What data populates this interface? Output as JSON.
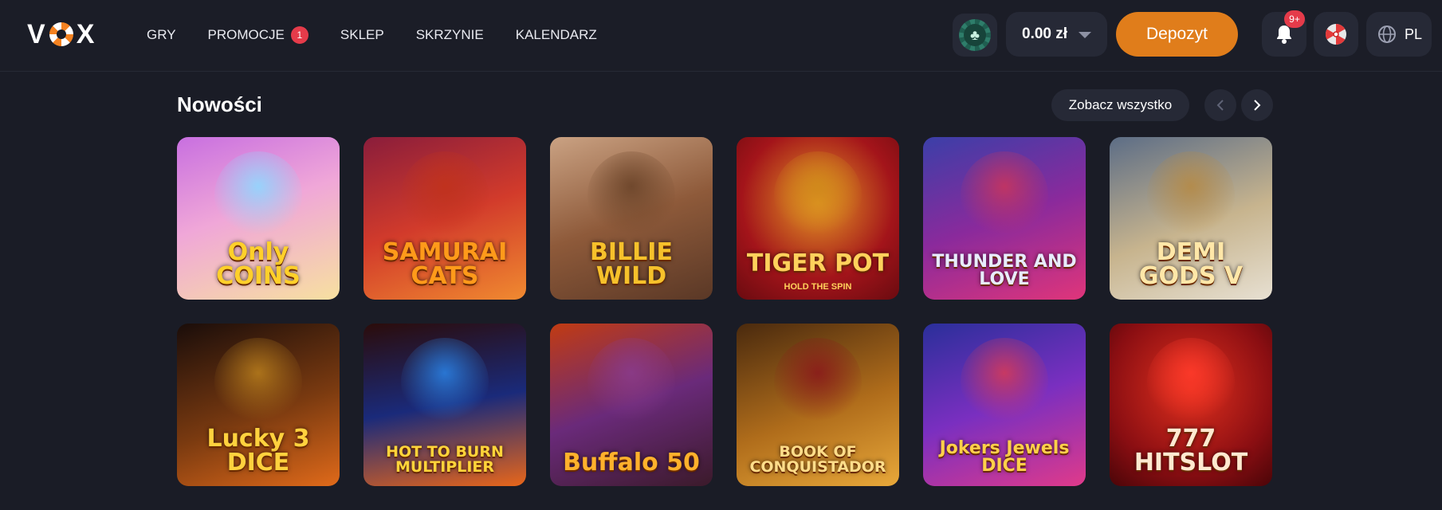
{
  "header": {
    "logo": "VOX",
    "nav": [
      {
        "label": "GRY"
      },
      {
        "label": "PROMOCJE",
        "badge": "1"
      },
      {
        "label": "SKLEP"
      },
      {
        "label": "SKRZYNIE"
      },
      {
        "label": "KALENDARZ"
      }
    ],
    "balance": "0.00 zł",
    "deposit_label": "Depozyt",
    "notifications_badge": "9+",
    "language": "PL"
  },
  "section": {
    "title": "Nowości",
    "see_all_label": "Zobacz wszystko"
  },
  "games": [
    {
      "title": "Only COINS",
      "bg": "linear-gradient(160deg,#c86fe0,#f0a7d8 45%,#f7e0a0)",
      "color": "#ffd02a",
      "art": "#8fd8ff"
    },
    {
      "title": "SAMURAI CATS",
      "bg": "linear-gradient(160deg,#8a1d3b,#d23b2b 50%,#f08a30)",
      "color": "#ff9a1a",
      "art": "#c0321c"
    },
    {
      "title": "BILLIE WILD",
      "bg": "linear-gradient(160deg,#caa283,#8e5a3a 50%,#5a3826)",
      "color": "#f6c12b",
      "art": "#6b4429"
    },
    {
      "title": "TIGER POT",
      "sub": "HOLD THE SPIN",
      "bg": "radial-gradient(circle at 50% 40%,#e59a25,#a3141a 60%,#6a0b10)",
      "color": "#ffd15c",
      "art": "#d08a1b"
    },
    {
      "title": "THUNDER AND LOVE",
      "bg": "linear-gradient(160deg,#3b3fa8,#8a2a9c 50%,#e0357a)",
      "color": "#e8ecff",
      "art": "#c7355e"
    },
    {
      "title": "DEMI GODS V",
      "bg": "linear-gradient(160deg,#5c6d86,#c7b48e 55%,#e7e0d2)",
      "color": "#ffe7a8",
      "art": "#b58a46"
    },
    {
      "title": "Lucky 3 DICE",
      "bg": "linear-gradient(160deg,#1a0d0a,#7a3a10 55%,#e06a1a)",
      "color": "#ffd23e",
      "art": "#b47a1c"
    },
    {
      "title": "HOT TO BURN MULTIPLIER",
      "bg": "linear-gradient(170deg,#2b0c0a,#1a2a7a 50%,#e8661a)",
      "color": "#ffd43a",
      "art": "#2a7fe0"
    },
    {
      "title": "Buffalo 50",
      "bg": "linear-gradient(160deg,#c13b12,#6a2a7a 50%,#3b1a2a)",
      "color": "#ffb12c",
      "art": "#8a3b8a"
    },
    {
      "title": "BOOK OF CONQUISTADOR",
      "bg": "linear-gradient(160deg,#4a2a0e,#b06d1b 55%,#e8a83a)",
      "color": "#ffdd8a",
      "art": "#8a1a1a"
    },
    {
      "title": "Jokers Jewels DICE",
      "bg": "linear-gradient(160deg,#2a2f9a,#7a2fc0 50%,#e03a8a)",
      "color": "#ffd04a",
      "art": "#d23a5a"
    },
    {
      "title": "777 HITSLOT",
      "bg": "radial-gradient(circle at 50% 40%,#e0301e,#8a0e12 65%,#4a0508)",
      "color": "#ffe9d0",
      "art": "#ff3a2a"
    }
  ]
}
